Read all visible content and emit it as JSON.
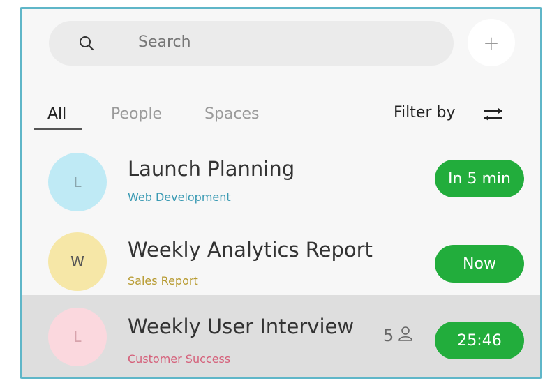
{
  "search": {
    "placeholder": "Search",
    "icon": "search-icon"
  },
  "add_button": {
    "label": "+",
    "icon": "plus-icon"
  },
  "tabs": [
    {
      "label": "All",
      "active": true
    },
    {
      "label": "People",
      "active": false
    },
    {
      "label": "Spaces",
      "active": false
    }
  ],
  "filter": {
    "label": "Filter by",
    "icon": "filter-sliders-icon"
  },
  "items": [
    {
      "initial": "L",
      "title": "Launch Planning",
      "subtitle": "Web Development",
      "status": "In 5 min",
      "avatar_color": "#bfeaf5",
      "subtitle_color": "#3a9ab3"
    },
    {
      "initial": "W",
      "title": "Weekly Analytics Report",
      "subtitle": "Sales Report",
      "status": "Now",
      "avatar_color": "#f6e7a7",
      "subtitle_color": "#b79a30"
    },
    {
      "initial": "L",
      "title": "Weekly User Interview",
      "subtitle": "Customer Success",
      "participants": "5",
      "status": "25:46",
      "avatar_color": "#fbd8de",
      "subtitle_color": "#d5607a",
      "selected": true
    }
  ],
  "colors": {
    "accent": "#22ad3c",
    "border": "#5fb6c8"
  }
}
